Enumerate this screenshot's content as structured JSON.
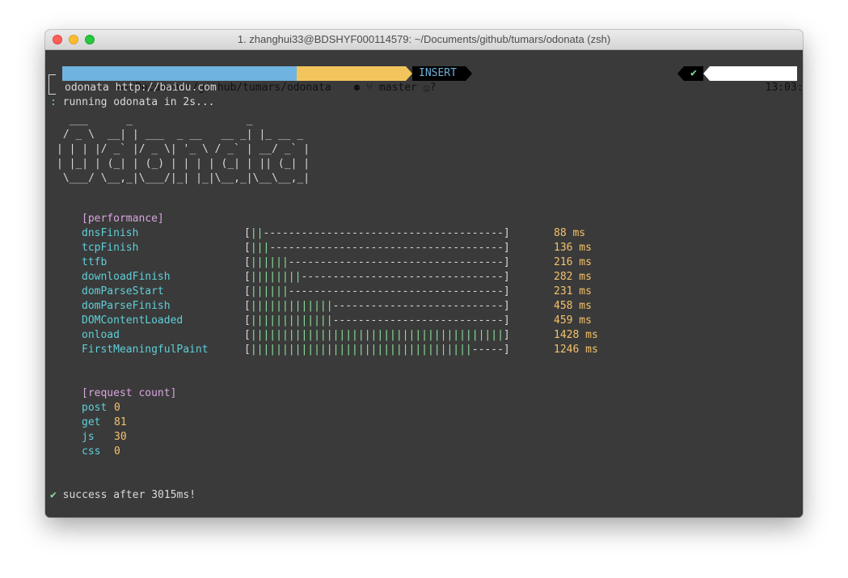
{
  "window": {
    "title": "1. zhanghui33@BDSHYF000114579: ~/Documents/github/tumars/odonata (zsh)"
  },
  "prompt": {
    "path": "~/Documents/github/tumars/odonata",
    "branch": "master",
    "mode": "INSERT",
    "time": "13:03:10",
    "command": "odonata http://baidu.com"
  },
  "running": "running odonata in 2s...",
  "ascii_lines": [
    "  ___      _                  _           ",
    " / _ \\  __| | ___  _ __   __ _| |_ __ _ ",
    "| | | |/ _` |/ _ \\| '_ \\ / _` | __/ _` |",
    "| |_| | (_| | (_) | | | | (_| | || (_| |",
    " \\___/ \\__,_|\\___/|_| |_|\\__,_|\\__\\__,_|"
  ],
  "performance": {
    "heading": "[performance]",
    "metrics": [
      {
        "name": "dnsFinish",
        "bar_filled": 2,
        "bar_empty": 38,
        "value": "88 ms"
      },
      {
        "name": "tcpFinish",
        "bar_filled": 3,
        "bar_empty": 37,
        "value": "136 ms"
      },
      {
        "name": "ttfb",
        "bar_filled": 6,
        "bar_empty": 34,
        "value": "216 ms"
      },
      {
        "name": "downloadFinish",
        "bar_filled": 8,
        "bar_empty": 32,
        "value": "282 ms"
      },
      {
        "name": "domParseStart",
        "bar_filled": 6,
        "bar_empty": 34,
        "value": "231 ms"
      },
      {
        "name": "domParseFinish",
        "bar_filled": 13,
        "bar_empty": 27,
        "value": "458 ms"
      },
      {
        "name": "DOMContentLoaded",
        "bar_filled": 13,
        "bar_empty": 27,
        "value": "459 ms"
      },
      {
        "name": "onload",
        "bar_filled": 40,
        "bar_empty": 0,
        "value": "1428 ms"
      },
      {
        "name": "FirstMeaningfulPaint",
        "bar_filled": 35,
        "bar_empty": 5,
        "value": "1246 ms"
      }
    ]
  },
  "requests": {
    "heading": "[request count]",
    "items": [
      {
        "label": "post",
        "value": "0"
      },
      {
        "label": "get",
        "value": "81"
      },
      {
        "label": "js",
        "value": "30"
      },
      {
        "label": "css",
        "value": "0"
      }
    ]
  },
  "result": "success after 3015ms!",
  "colors": {
    "path_bg": "#6fb3e0",
    "git_bg": "#f2c55c",
    "terminal_bg": "#3a3a3a",
    "metric_name": "#5fcfd8",
    "bar_fill": "#8be09a",
    "value": "#f5c26b",
    "section": "#d9a5e0"
  }
}
